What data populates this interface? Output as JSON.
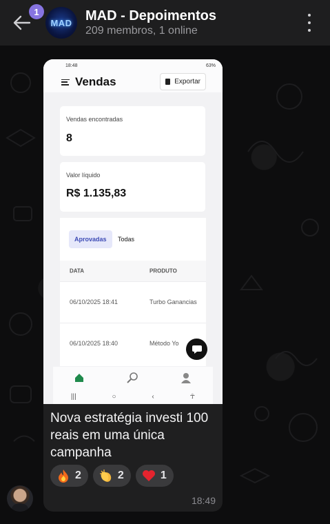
{
  "header": {
    "unread_count": "1",
    "avatar_text": "MAD",
    "title": "MAD - Depoimentos",
    "subtitle": "209 membros, 1 online"
  },
  "screenshot": {
    "status_time": "18:48",
    "battery": "63%",
    "app_title": "Vendas",
    "export_label": "Exportar",
    "sales_found_label": "Vendas encontradas",
    "sales_found_value": "8",
    "net_value_label": "Valor líquido",
    "net_value": "R$ 1.135,83",
    "tabs": [
      "Aprovadas",
      "Todas"
    ],
    "table_headers": [
      "DATA",
      "PRODUTO"
    ],
    "rows": [
      {
        "date": "06/10/2025 18:41",
        "product": "Turbo Ganancias"
      },
      {
        "date": "06/10/2025 18:40",
        "product": "Método Yo"
      }
    ]
  },
  "message": {
    "caption": "Nova estratégia investi 100 reais em uma única campanha",
    "reactions": [
      {
        "emoji": "fire-emoji",
        "count": "2"
      },
      {
        "emoji": "clapping-hands-emoji",
        "count": "2"
      },
      {
        "emoji": "red-heart-emoji",
        "count": "1"
      }
    ],
    "time": "18:49"
  },
  "colors": {
    "header_bg": "#1e1e1f",
    "bubble_bg": "#1f1f20",
    "accent": "#8774e1",
    "chip_bg": "#e6e8fa",
    "chip_text": "#3d4bb5",
    "nav_active": "#1f8a4c"
  }
}
